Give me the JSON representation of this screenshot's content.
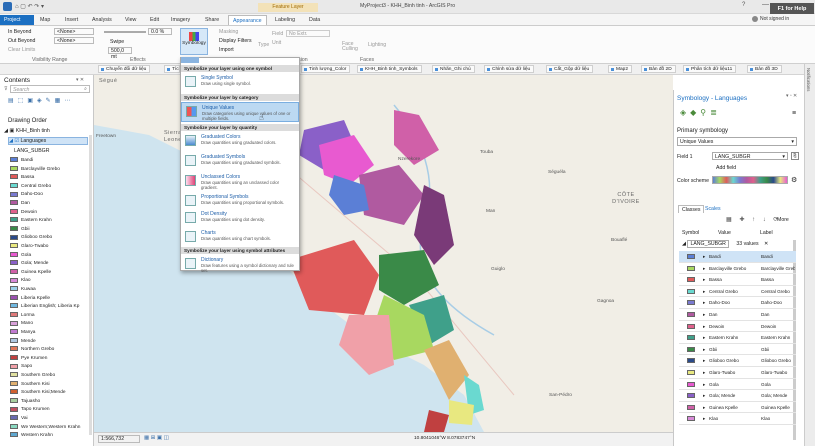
{
  "titlebar": {
    "context_tab": "Feature Layer",
    "title": "MyProject3 - KHH_Binh tinh - ArcGIS Pro",
    "help": "F1 for Help",
    "signin": "Not signed in"
  },
  "menu": [
    "Project",
    "Map",
    "Insert",
    "Analysis",
    "View",
    "Edit",
    "Imagery",
    "Share",
    "Appearance",
    "Labeling",
    "Data"
  ],
  "ribbon": {
    "in_beyond": "In Beyond",
    "out_beyond": "Out Beyond",
    "clear_limits": "Clear Limits",
    "none1": "<None>",
    "none2": "<None>",
    "visibility_range": "Visibility Range",
    "transparency": "0.0 %",
    "swipe": "Swipe",
    "height": "500,0 mt",
    "effects": "Effects",
    "symbology": "Symbology",
    "masking": "Masking",
    "display_filters": "Display Filters",
    "import": "Import",
    "field": "Field",
    "no_ext": "No Extr.",
    "type": "Type",
    "unit": "Unit",
    "extrusion": "Extrusion",
    "face_culling": "Face Culling",
    "lighting": "Lighting",
    "faces": "Faces"
  },
  "bookmarks": [
    "Chuyển đổi dữ liệu",
    "Tích",
    "Tinh lượng_Color",
    "KHH_Binh tinh_Symbols",
    "Nhãn_Ghi chú",
    "Chỉnh sửa dữ liệu",
    "Cắt_Gộp dữ liệu",
    "Map2",
    "Bản đồ 2D",
    "Phân tích dữ liệu11",
    "Bản đồ 3D"
  ],
  "contents": {
    "title": "Contents",
    "search": "Search",
    "drawing_order": "Drawing Order",
    "map": "KHH_Binh tinh",
    "layer": "Languages",
    "field": "LANG_SUBGR",
    "items": [
      {
        "label": "Bandi",
        "color": "#5b7fd6"
      },
      {
        "label": "Barclayville Grebo",
        "color": "#a8d860"
      },
      {
        "label": "Bassa",
        "color": "#e05a5a"
      },
      {
        "label": "Central Grebo",
        "color": "#6ad9d0"
      },
      {
        "label": "Daho-Doo",
        "color": "#7a7ad0"
      },
      {
        "label": "Dan",
        "color": "#b05aa0"
      },
      {
        "label": "Dewoin",
        "color": "#e0608c"
      },
      {
        "label": "Eastern Krahn",
        "color": "#3fa08a"
      },
      {
        "label": "Gbii",
        "color": "#3a8a48"
      },
      {
        "label": "Glioboo Grebo",
        "color": "#2a4a8a"
      },
      {
        "label": "Glaro-Twabo",
        "color": "#e8e880"
      },
      {
        "label": "Gola",
        "color": "#e85ad0"
      },
      {
        "label": "Gola; Mende",
        "color": "#8a60c8"
      },
      {
        "label": "Guinea Kpelle",
        "color": "#d060a8"
      },
      {
        "label": "Klao",
        "color": "#d88ad8"
      },
      {
        "label": "Kuwaa",
        "color": "#9ad0e8"
      },
      {
        "label": "Liberia Kpelle",
        "color": "#9a50b0"
      },
      {
        "label": "Liberian English; Liberia Kp",
        "color": "#70b8e0"
      },
      {
        "label": "Lorma",
        "color": "#e07a7a"
      },
      {
        "label": "Mano",
        "color": "#d8a0d8"
      },
      {
        "label": "Manya",
        "color": "#c07ad0"
      },
      {
        "label": "Mende",
        "color": "#b0c8e0"
      },
      {
        "label": "Northern Grebo",
        "color": "#e0785a"
      },
      {
        "label": "Pye Krumen",
        "color": "#c04040"
      },
      {
        "label": "Sapo",
        "color": "#f0a0a8"
      },
      {
        "label": "Southern Grebo",
        "color": "#e0e0a0"
      },
      {
        "label": "Southern Kisi",
        "color": "#e0b070"
      },
      {
        "label": "Southern Kisi;Mende",
        "color": "#d06030"
      },
      {
        "label": "Tajuasho",
        "color": "#a8d0a0"
      },
      {
        "label": "Tapo Krumen",
        "color": "#c05060"
      },
      {
        "label": "Vai",
        "color": "#6a6ab0"
      },
      {
        "label": "We Western;Western Krahn",
        "color": "#8ad8c0"
      },
      {
        "label": "Western Krahn",
        "color": "#60a8d0"
      }
    ]
  },
  "dropdown": {
    "header1": "Symbolize your layer using one symbol",
    "single_title": "Single Symbol",
    "single_desc": "Draw using single symbol.",
    "header2": "Symbolize your layer by category",
    "uv_title": "Unique Values",
    "uv_desc": "Draw categories using unique values of one or multiple fields.",
    "header3": "Symbolize your layer by quantity",
    "gc_title": "Graduated Colors",
    "gc_desc": "Draw quantities using graduated colors.",
    "gs_title": "Graduated Symbols",
    "gs_desc": "Draw quantities using graduated symbols.",
    "uc_title": "Unclassed Colors",
    "uc_desc": "Draw quantities using an unclassed color gradient.",
    "ps_title": "Proportional Symbols",
    "ps_desc": "Draw quantities using proportional symbols.",
    "dd_title": "Dot Density",
    "dd_desc": "Draw quantities using dot density.",
    "ch_title": "Charts",
    "ch_desc": "Draw quantities using chart symbols.",
    "header4": "Symbolize your layer using symbol attributes",
    "dict_title": "Dictionary",
    "dict_desc": "Draw features using a symbol dictionary and rule set."
  },
  "map": {
    "places": [
      "Ségué",
      "Sierra Leone",
      "Touba",
      "Séguéla",
      "Nzerekore",
      "Man",
      "CÔTE D'IVOIRE",
      "Guiglo",
      "Bouaflé",
      "Gagnoa",
      "San-Pédro",
      "Freetown"
    ],
    "scale": "1:566,732",
    "coords": "10.8041046°W 8.0783747°N"
  },
  "sym": {
    "title": "Symbology - Languages",
    "primary": "Primary symbology",
    "method": "Unique Values",
    "field_label": "Field 1",
    "field_value": "LANG_SUBGR",
    "add_field": "Add field",
    "color_scheme": "Color scheme",
    "tab_classes": "Classes",
    "tab_scales": "Scales",
    "more": "More",
    "col_symbol": "Symbol",
    "col_value": "Value",
    "col_label": "Label",
    "group": "LANG_SUBGR",
    "count": "33 values",
    "rows": [
      {
        "v": "Bandi",
        "c": "#5b7fd6"
      },
      {
        "v": "Barclayville Grebo",
        "c": "#a8d860"
      },
      {
        "v": "Bassa",
        "c": "#e05a5a"
      },
      {
        "v": "Central Grebo",
        "c": "#6ad9d0"
      },
      {
        "v": "Daho-Doo",
        "c": "#7a7ad0"
      },
      {
        "v": "Dan",
        "c": "#b05aa0"
      },
      {
        "v": "Dewoin",
        "c": "#e0608c"
      },
      {
        "v": "Eastern Krahn",
        "c": "#3fa08a"
      },
      {
        "v": "Gbii",
        "c": "#3a8a48"
      },
      {
        "v": "Glioboo Grebo",
        "c": "#2a4a8a"
      },
      {
        "v": "Glaro-Twabo",
        "c": "#e8e880"
      },
      {
        "v": "Gola",
        "c": "#e85ad0"
      },
      {
        "v": "Gola; Mende",
        "c": "#8a60c8"
      },
      {
        "v": "Guinea Kpelle",
        "c": "#d060a8"
      },
      {
        "v": "Klao",
        "c": "#d88ad8"
      }
    ]
  }
}
